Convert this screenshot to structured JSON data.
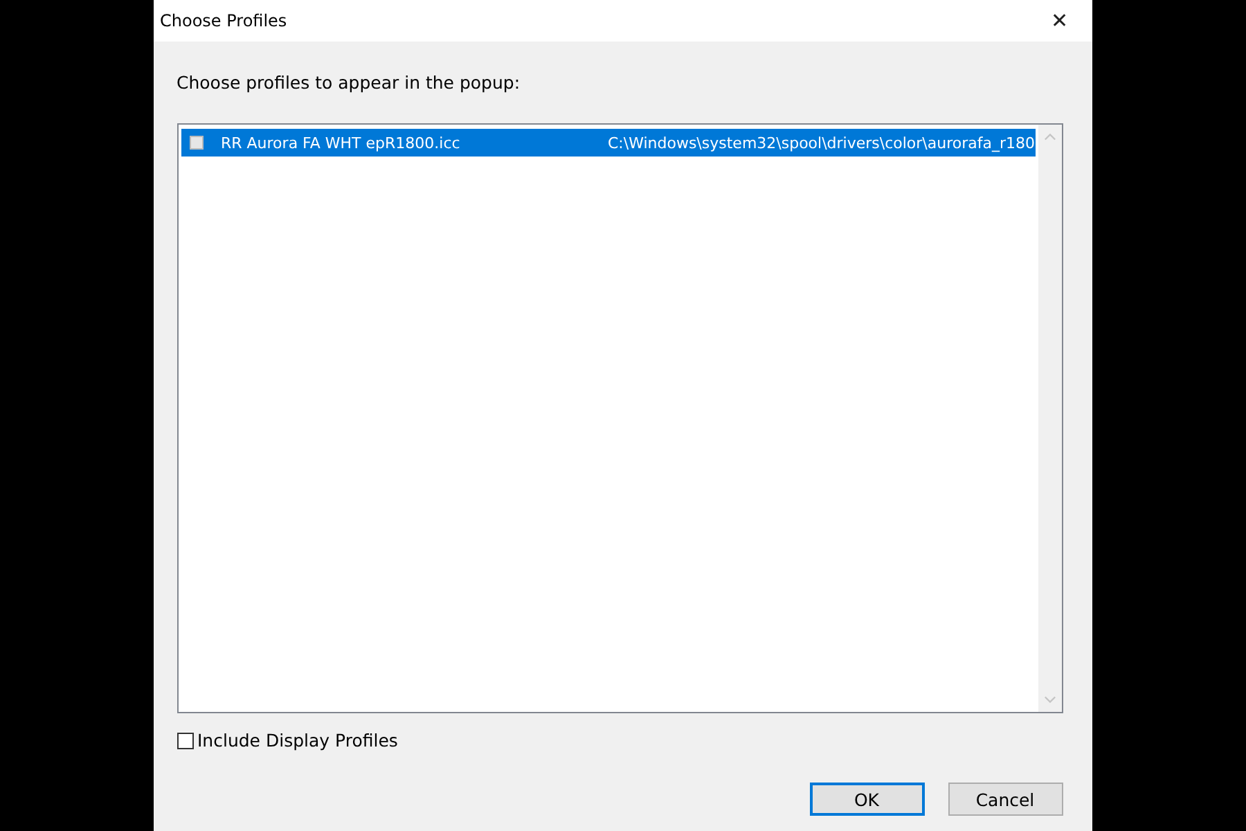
{
  "window": {
    "title": "Choose Profiles",
    "close": "✕"
  },
  "prompt": "Choose profiles to appear in the popup:",
  "profiles": [
    {
      "name": "RR Aurora FA WHT epR1800.icc",
      "path": "C:\\Windows\\system32\\spool\\drivers\\color\\aurorafa_r180",
      "checked": false,
      "selected": true
    }
  ],
  "include_display": {
    "label": "Include Display Profiles",
    "checked": false
  },
  "buttons": [
    {
      "label": "OK",
      "default": true
    },
    {
      "label": "Cancel",
      "default": false
    }
  ]
}
